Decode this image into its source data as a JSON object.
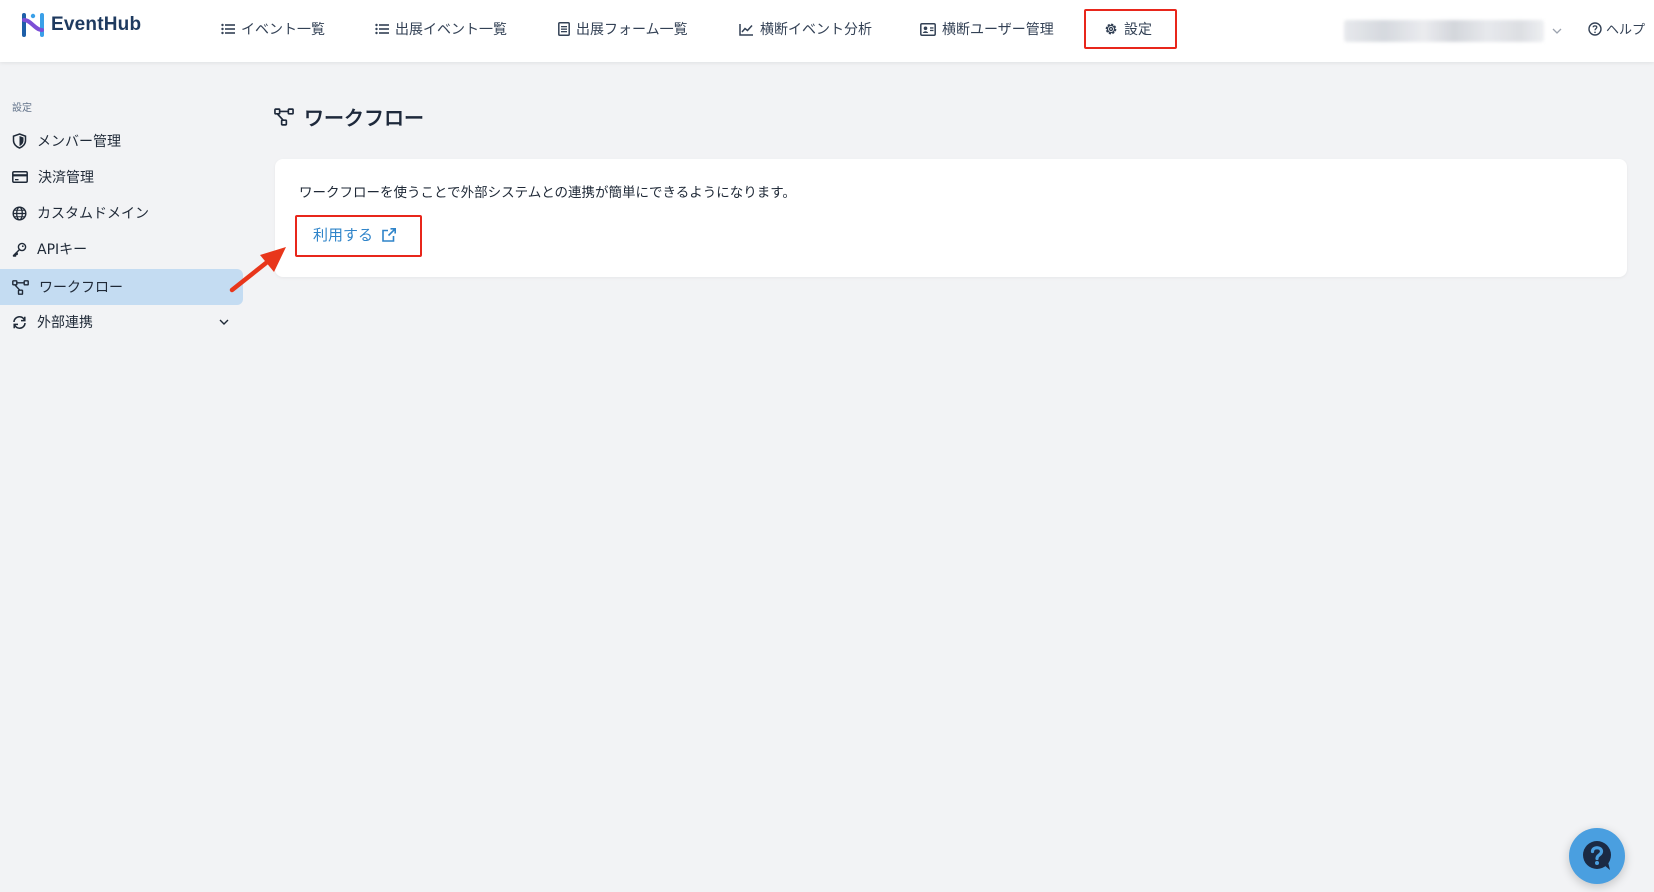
{
  "app": {
    "name": "EventHub"
  },
  "topnav": {
    "items": [
      {
        "label": "イベント一覧",
        "icon": "list-icon"
      },
      {
        "label": "出展イベント一覧",
        "icon": "list-icon"
      },
      {
        "label": "出展フォーム一覧",
        "icon": "form-icon"
      },
      {
        "label": "横断イベント分析",
        "icon": "chart-line-icon"
      },
      {
        "label": "横断ユーザー管理",
        "icon": "id-card-icon"
      },
      {
        "label": "設定",
        "icon": "gear-icon"
      }
    ],
    "help_label": "ヘルプ"
  },
  "sidebar": {
    "section_label": "設定",
    "items": [
      {
        "label": "メンバー管理",
        "icon": "shield-icon"
      },
      {
        "label": "決済管理",
        "icon": "credit-card-icon"
      },
      {
        "label": "カスタムドメイン",
        "icon": "globe-icon"
      },
      {
        "label": "APIキー",
        "icon": "key-icon"
      },
      {
        "label": "ワークフロー",
        "icon": "workflow-icon",
        "active": true
      },
      {
        "label": "外部連携",
        "icon": "sync-icon",
        "expandable": true
      }
    ]
  },
  "main": {
    "title": "ワークフロー",
    "description": "ワークフローを使うことで外部システムとの連携が簡単にできるようになります。",
    "use_label": "利用する"
  },
  "colors": {
    "accent": "#2f84c9",
    "active_bg": "#c4dcf2",
    "annotation": "#e8261b",
    "page_bg": "#f2f3f5"
  }
}
